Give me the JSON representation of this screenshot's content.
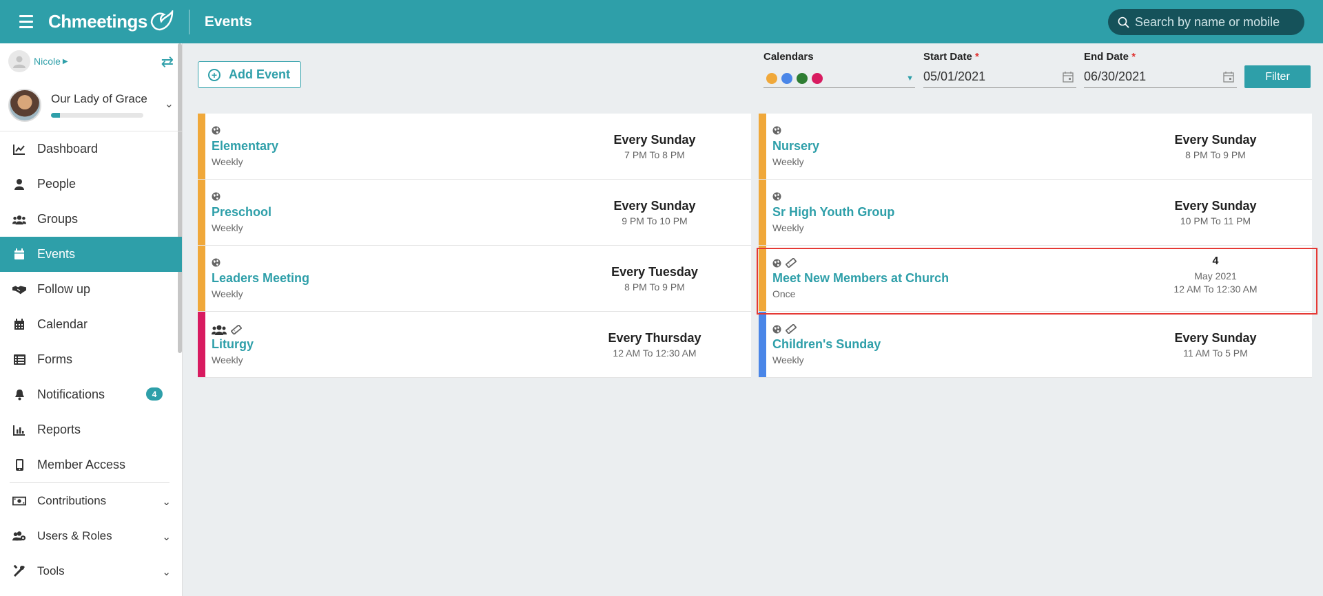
{
  "header": {
    "logo_text": "Chmeetings",
    "page_title": "Events",
    "search_placeholder": "Search by name or mobile"
  },
  "sidebar": {
    "user_name": "Nicole",
    "org_name": "Our Lady of Grace",
    "org_progress": 0.1,
    "items": [
      {
        "label": "Dashboard",
        "icon": "chart-line-icon"
      },
      {
        "label": "People",
        "icon": "person-icon"
      },
      {
        "label": "Groups",
        "icon": "users-icon"
      },
      {
        "label": "Events",
        "icon": "calendar-icon",
        "active": true
      },
      {
        "label": "Follow up",
        "icon": "handshake-icon"
      },
      {
        "label": "Calendar",
        "icon": "calendar-grid-icon"
      },
      {
        "label": "Forms",
        "icon": "list-icon"
      },
      {
        "label": "Notifications",
        "icon": "bell-icon",
        "badge": "4"
      },
      {
        "label": "Reports",
        "icon": "bar-chart-icon"
      },
      {
        "label": "Member Access",
        "icon": "mobile-icon"
      },
      {
        "label": "Contributions",
        "icon": "money-icon",
        "expandable": true
      },
      {
        "label": "Users & Roles",
        "icon": "users-cog-icon",
        "expandable": true
      },
      {
        "label": "Tools",
        "icon": "tools-icon",
        "expandable": true
      }
    ]
  },
  "toolbar": {
    "add_event_label": "Add Event",
    "calendars_label": "Calendars",
    "calendar_colors": [
      "#f0a83a",
      "#4a86e8",
      "#2e7d32",
      "#d81b60"
    ],
    "start_date_label": "Start Date",
    "start_date_value": "05/01/2021",
    "end_date_label": "End Date",
    "end_date_value": "06/30/2021",
    "required_mark": "*",
    "filter_label": "Filter"
  },
  "events_left": [
    {
      "title": "Elementary",
      "freq": "Weekly",
      "when": "Every Sunday",
      "time": "7 PM To 8 PM",
      "color": "#f0a83a",
      "icons": [
        "globe-icon"
      ]
    },
    {
      "title": "Preschool",
      "freq": "Weekly",
      "when": "Every Sunday",
      "time": "9 PM To 10 PM",
      "color": "#f0a83a",
      "icons": [
        "globe-icon"
      ]
    },
    {
      "title": "Leaders Meeting",
      "freq": "Weekly",
      "when": "Every Tuesday",
      "time": "8 PM To 9 PM",
      "color": "#f0a83a",
      "icons": [
        "globe-icon"
      ]
    },
    {
      "title": "Liturgy",
      "freq": "Weekly",
      "when": "Every Thursday",
      "time": "12 AM To 12:30 AM",
      "color": "#d81b60",
      "icons": [
        "users-icon",
        "ticket-icon"
      ]
    }
  ],
  "events_right": [
    {
      "title": "Nursery",
      "freq": "Weekly",
      "when": "Every Sunday",
      "time": "8 PM To 9 PM",
      "color": "#f0a83a",
      "icons": [
        "globe-icon"
      ]
    },
    {
      "title": "Sr High Youth Group",
      "freq": "Weekly",
      "when": "Every Sunday",
      "time": "10 PM To 11 PM",
      "color": "#f0a83a",
      "icons": [
        "globe-icon"
      ]
    },
    {
      "title": "Meet New Members at Church",
      "freq": "Once",
      "day": "4",
      "month": "May 2021",
      "time": "12 AM To 12:30 AM",
      "color": "#f0a83a",
      "icons": [
        "globe-icon",
        "ticket-icon"
      ],
      "once": true
    },
    {
      "title": "Children's Sunday",
      "freq": "Weekly",
      "when": "Every Sunday",
      "time": "11 AM To 5 PM",
      "color": "#4a86e8",
      "icons": [
        "globe-icon",
        "ticket-icon"
      ]
    }
  ]
}
